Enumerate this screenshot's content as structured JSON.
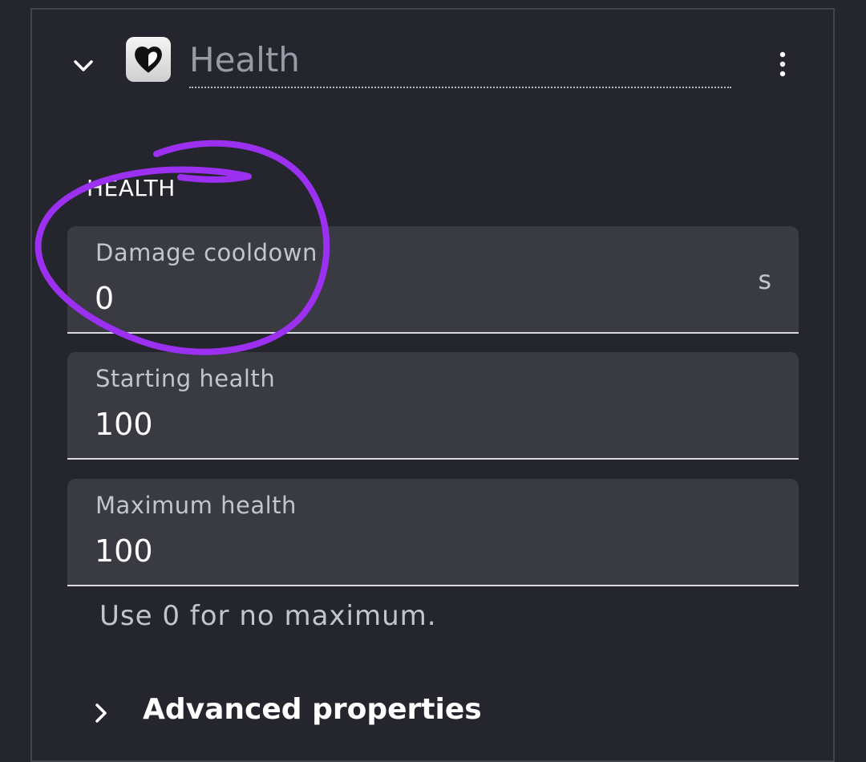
{
  "behavior": {
    "name": "Health",
    "icon": "heart-icon"
  },
  "section": {
    "heading": "HEALTH"
  },
  "fields": [
    {
      "label": "Damage cooldown",
      "value": "0",
      "unit": "s"
    },
    {
      "label": "Starting health",
      "value": "100"
    },
    {
      "label": "Maximum health",
      "value": "100"
    }
  ],
  "helper": {
    "max_health": "Use 0 for no maximum."
  },
  "advanced": {
    "label": "Advanced properties"
  },
  "colors": {
    "background": "#25252d",
    "field_background": "#3a3a43",
    "annotation": "#9b30f0"
  }
}
